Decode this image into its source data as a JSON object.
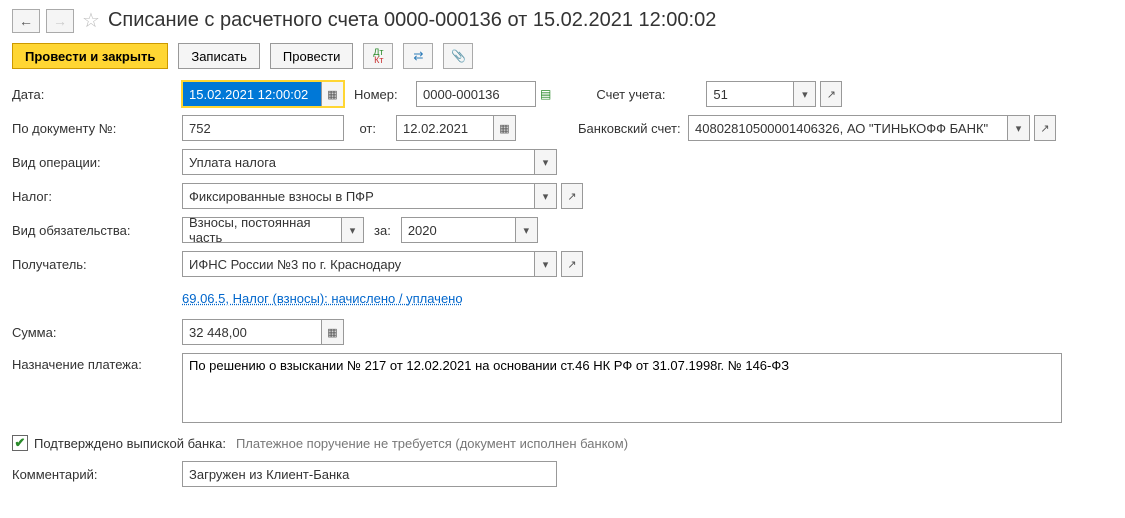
{
  "title": "Списание с расчетного счета 0000-000136 от 15.02.2021 12:00:02",
  "toolbar": {
    "submit_close": "Провести и закрыть",
    "save": "Записать",
    "submit": "Провести"
  },
  "labels": {
    "date": "Дата:",
    "number": "Номер:",
    "account": "Счет учета:",
    "by_doc_no": "По документу №:",
    "from": "от:",
    "bank_account": "Банковский счет:",
    "op_type": "Вид операции:",
    "tax": "Налог:",
    "liability_type": "Вид обязательства:",
    "for": "за:",
    "recipient": "Получатель:",
    "amount": "Сумма:",
    "purpose": "Назначение платежа:",
    "confirmed": "Подтверждено выпиской банка:",
    "confirmed_note": "Платежное поручение не требуется (документ исполнен банком)",
    "comment": "Комментарий:"
  },
  "values": {
    "date": "15.02.2021 12:00:02",
    "number": "0000-000136",
    "account": "51",
    "by_doc_no": "752",
    "from_date": "12.02.2021",
    "bank_account": "40802810500001406326, АО \"ТИНЬКОФФ БАНК\"",
    "op_type": "Уплата налога",
    "tax": "Фиксированные взносы в ПФР",
    "liability_type": "Взносы, постоянная часть",
    "for_year": "2020",
    "recipient": "ИФНС России №3 по г. Краснодару",
    "kbk_link": "69.06.5, Налог (взносы): начислено / уплачено",
    "amount": "32 448,00",
    "purpose": "По решению о взыскании № 217 от 12.02.2021 на основании ст.46 НК РФ от 31.07.1998г. № 146-ФЗ",
    "comment": "Загружен из Клиент-Банка"
  }
}
